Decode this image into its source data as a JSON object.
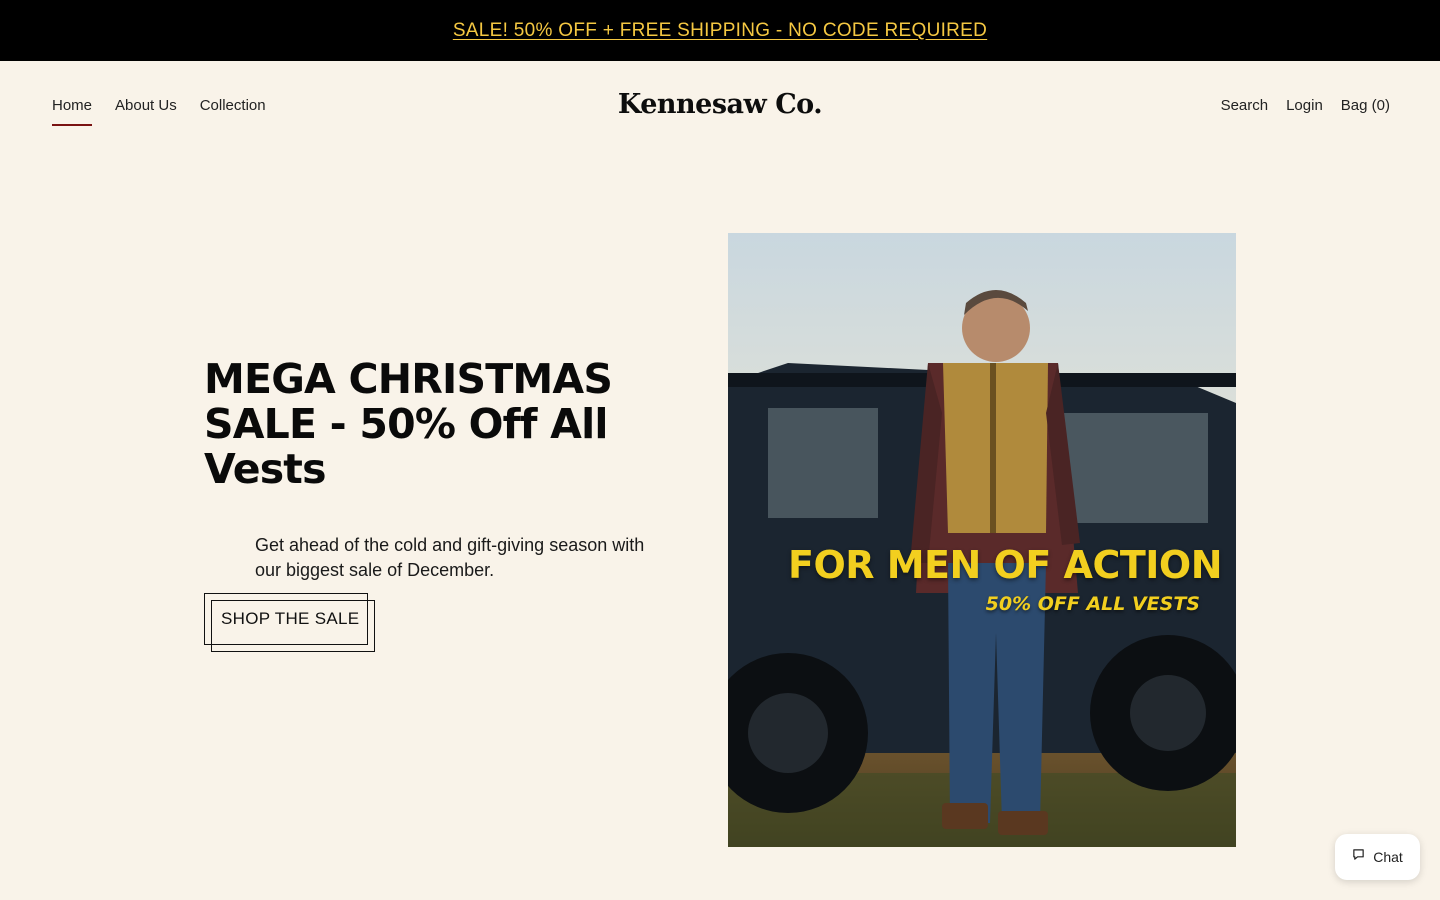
{
  "announcement": {
    "text": "SALE! 50% OFF + FREE SHIPPING - NO CODE REQUIRED",
    "color": "#f5c842"
  },
  "header": {
    "nav_left": [
      {
        "label": "Home",
        "active": true
      },
      {
        "label": "About Us",
        "active": false
      },
      {
        "label": "Collection",
        "active": false
      }
    ],
    "logo": "Kennesaw Co.",
    "nav_right": {
      "search": "Search",
      "login": "Login",
      "bag": "Bag (0)"
    }
  },
  "hero": {
    "title": "MEGA CHRISTMAS SALE - 50% Off All Vests",
    "subtitle": "Get ahead of the cold and gift-giving season with our biggest sale of December.",
    "cta_label": "SHOP THE SALE",
    "image": {
      "headline": "FOR MEN OF ACTION",
      "subline": "50% OFF ALL VESTS",
      "text_color": "#f2cf1f"
    }
  },
  "chat": {
    "label": "Chat",
    "icon": "chat-bubble-icon"
  },
  "colors": {
    "background": "#f9f3e9",
    "accent": "#7a1212",
    "announcement_bg": "#000000"
  }
}
